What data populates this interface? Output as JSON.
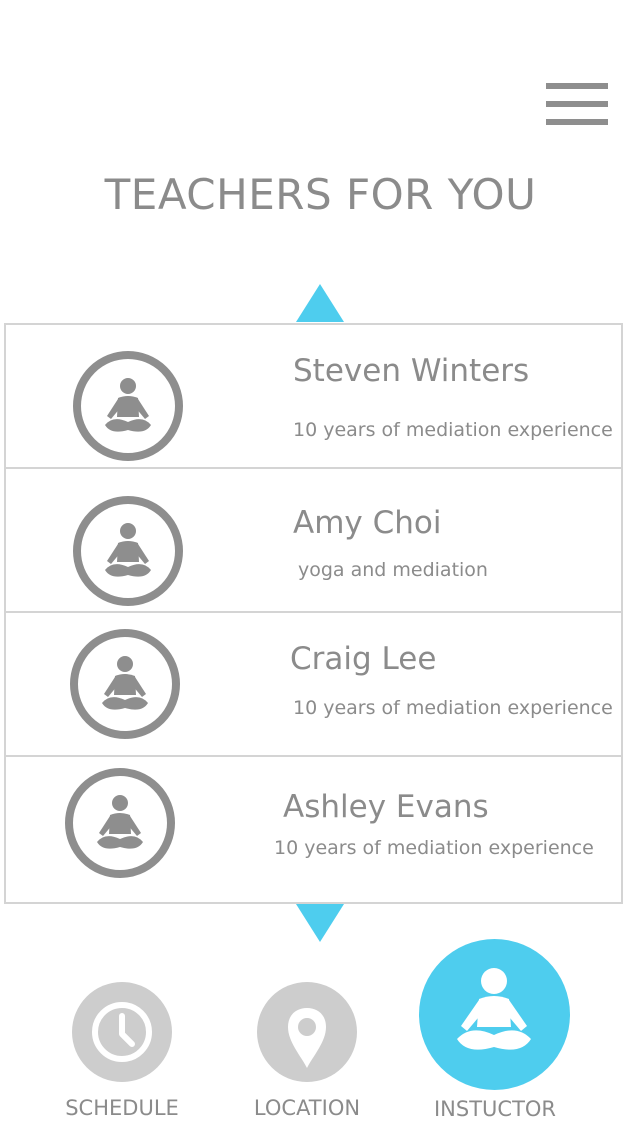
{
  "header": {
    "title": "TEACHERS FOR YOU",
    "menu_icon": "hamburger-menu-icon"
  },
  "teachers": [
    {
      "name": "Steven Winters",
      "description": "10 years of mediation experience",
      "icon": "meditation-person-icon"
    },
    {
      "name": "Amy Choi",
      "description": "yoga and mediation",
      "icon": "meditation-person-icon"
    },
    {
      "name": "Craig Lee",
      "description": "10 years of mediation experience",
      "icon": "meditation-person-icon"
    },
    {
      "name": "Ashley Evans",
      "description": "10 years of mediation experience",
      "icon": "meditation-person-icon"
    }
  ],
  "scroll": {
    "up_icon": "triangle-up-icon",
    "down_icon": "triangle-down-icon"
  },
  "bottom_nav": {
    "items": [
      {
        "label": "SCHEDULE",
        "icon": "clock-icon",
        "active": false
      },
      {
        "label": "LOCATION",
        "icon": "map-pin-icon",
        "active": false
      },
      {
        "label": "INSTUCTOR",
        "icon": "meditation-person-icon",
        "active": true
      }
    ]
  },
  "colors": {
    "accent": "#4ecdee",
    "text_gray": "#8b8b8b",
    "inactive_circle": "#cdcdcd",
    "border": "#d4d4d4"
  }
}
